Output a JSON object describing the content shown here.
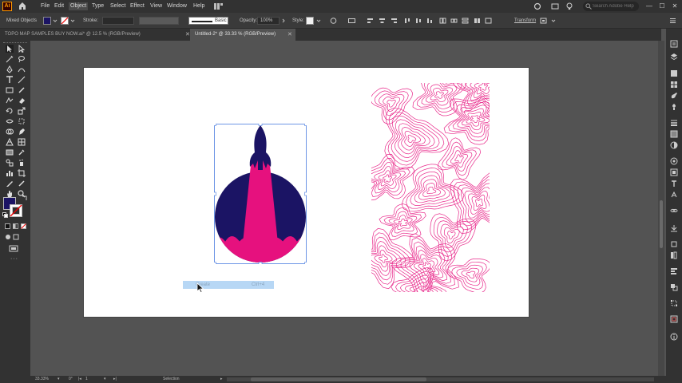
{
  "app": {
    "logo_text": "Ai",
    "menu": [
      "File",
      "Edit",
      "Object",
      "Type",
      "Select",
      "Effect",
      "View",
      "Window",
      "Help"
    ],
    "active_menu": "Object",
    "search_placeholder": "Search Adobe Help",
    "window_controls": [
      "—",
      "☐",
      "✕"
    ]
  },
  "control_bar": {
    "selection_label": "Mixed Objects",
    "stroke_label": "Stroke:",
    "stroke_profile": "Basic",
    "opacity_label": "Opacity:",
    "opacity_value": "100%",
    "style_label": "Style:",
    "transform_label": "Transform",
    "fill_color": "#1b1464",
    "stroke_color": "#ffffff"
  },
  "tabs": [
    {
      "label": "TOPO MAP SAMPLES BUY NOW.ai* @ 12.5 % (RGB/Preview)",
      "active": false
    },
    {
      "label": "Untitled-2* @ 33.33 % (RGB/Preview)",
      "active": true
    }
  ],
  "tab_close_glyph": "✕",
  "status_bar": {
    "zoom": "33.33%",
    "rotation": "0°",
    "artboard_number": "1",
    "tool_name": "Selection"
  },
  "context_menu": {
    "item_label": "Create",
    "item_shortcut": "Ctrl+4"
  },
  "colors": {
    "accent_pink": "#e6117e",
    "navy": "#1b1464",
    "topo_line": "#e6117e",
    "selection_blue": "#4a7ce0",
    "menu_highlight": "#b7d7f5"
  },
  "icons": {
    "home": "home-icon",
    "cursor": "arrow-cursor-icon"
  }
}
